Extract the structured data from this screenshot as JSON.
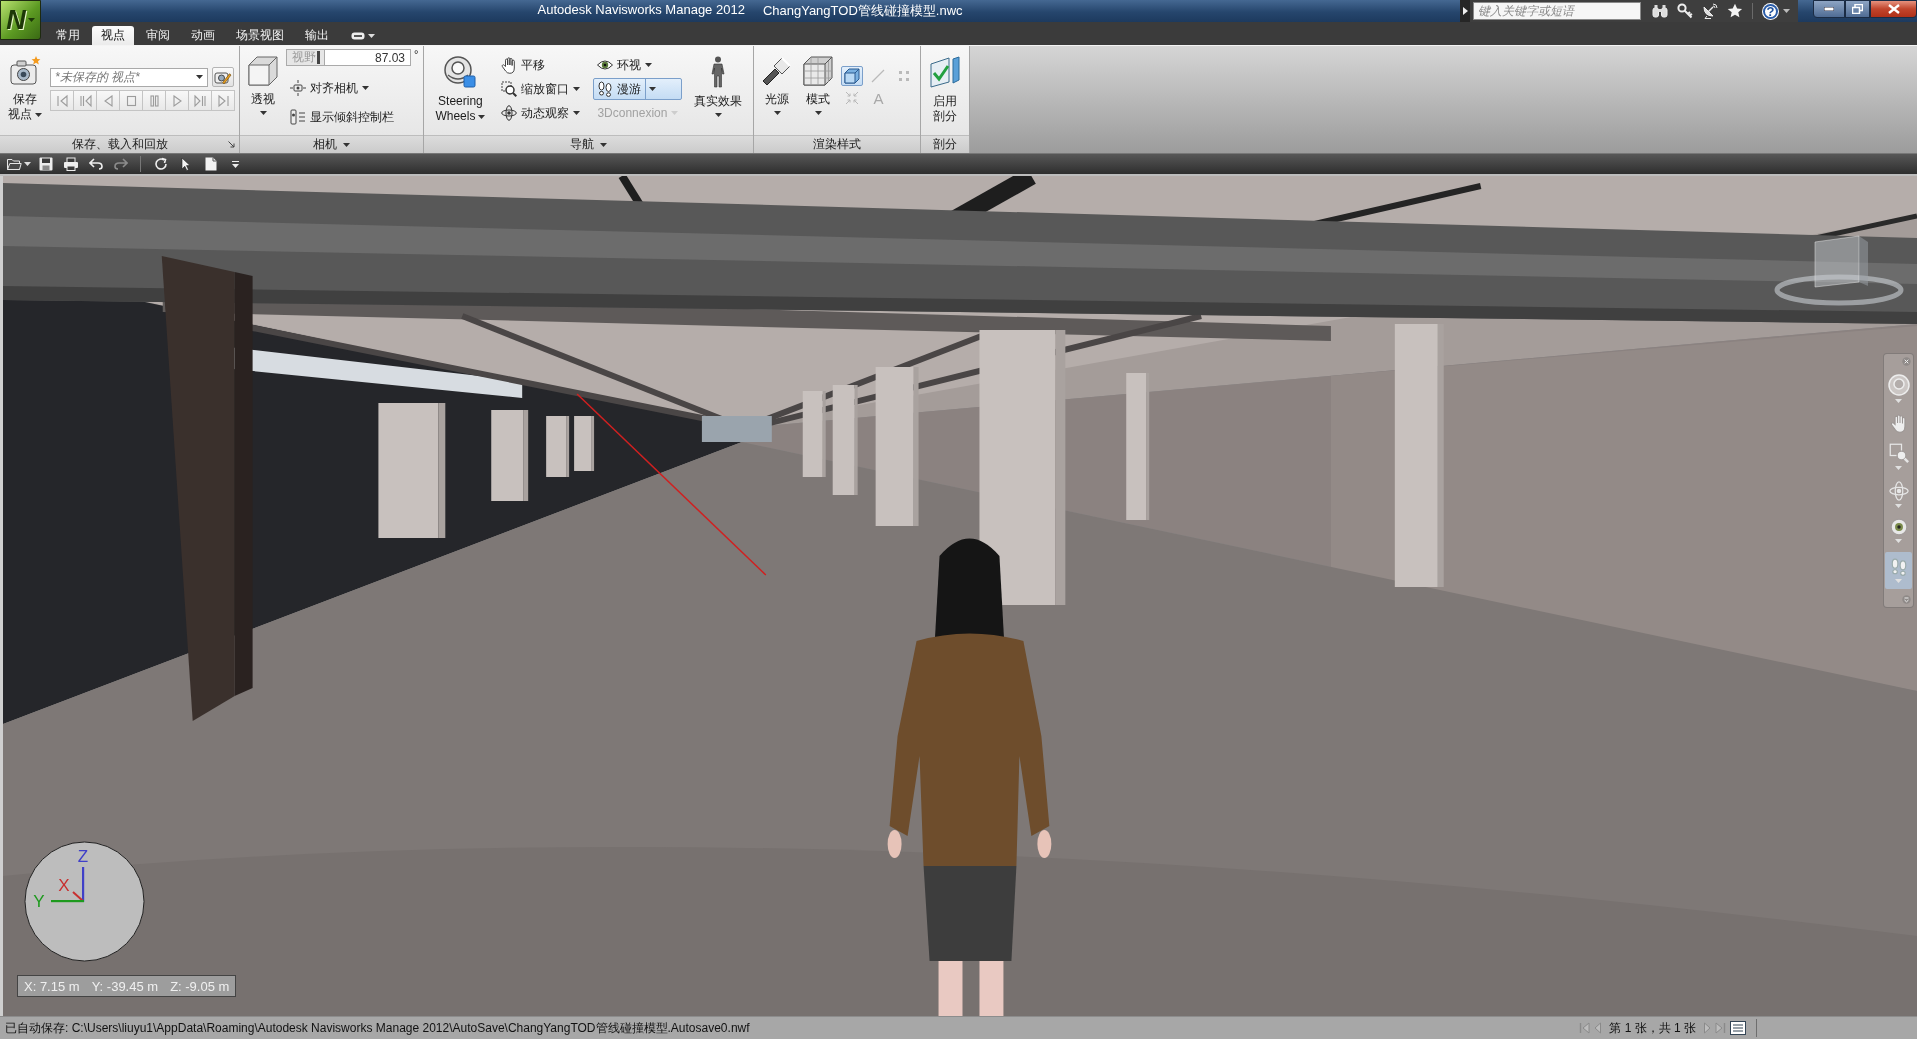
{
  "app_menu": {
    "label": "N"
  },
  "title_bar": {
    "title": "Autodesk Navisworks Manage 2012",
    "document": "ChangYangTOD管线碰撞模型.nwc",
    "search": {
      "placeholder": "键入关键字或短语"
    },
    "help": {
      "label": "?",
      "menu": true
    }
  },
  "ribbon_tabs": [
    {
      "label": "常用",
      "selected": false
    },
    {
      "label": "视点",
      "selected": true
    },
    {
      "label": "审阅",
      "selected": false
    },
    {
      "label": "动画",
      "selected": false
    },
    {
      "label": "场景视图",
      "selected": false
    },
    {
      "label": "输出",
      "selected": false
    }
  ],
  "ribbon_panels": [
    {
      "title": "保存、载入和回放",
      "menu": false,
      "launcher": true,
      "columns": [
        [
          {
            "kind": "large",
            "lines": [
              "保存",
              "视点"
            ],
            "menu": true
          }
        ],
        [
          {
            "kind": "combo",
            "value": "*未保存的 视点*"
          },
          {
            "kind": "playback",
            "disabled": true
          }
        ]
      ]
    },
    {
      "title": "相机",
      "menu": true,
      "launcher": false,
      "columns": [
        [
          {
            "kind": "large",
            "lines": [
              "透视"
            ],
            "menu": true
          }
        ],
        [
          {
            "kind": "spin",
            "label": "视野",
            "level": 0.88,
            "value": "87.03",
            "unit": "°"
          },
          {
            "kind": "small",
            "label": "对齐相机",
            "menu": true,
            "selected": false,
            "disabled": false
          },
          {
            "kind": "small",
            "label": "显示倾斜控制栏",
            "menu": false,
            "selected": false,
            "disabled": false
          }
        ]
      ]
    },
    {
      "title": "导航",
      "menu": true,
      "launcher": false,
      "columns": [
        [
          {
            "kind": "large",
            "lines": [
              "Steering",
              "Wheels"
            ],
            "menu": true
          }
        ],
        [
          {
            "kind": "small",
            "label": "平移",
            "menu": false,
            "selected": false,
            "disabled": false
          },
          {
            "kind": "small",
            "label": "缩放窗口",
            "menu": true,
            "selected": false,
            "disabled": false
          },
          {
            "kind": "small",
            "label": "动态观察",
            "menu": true,
            "selected": false,
            "disabled": false
          }
        ],
        [
          {
            "kind": "small",
            "label": "环视",
            "menu": true,
            "selected": false,
            "disabled": false
          },
          {
            "kind": "small",
            "label": "漫游",
            "menu": true,
            "selected": true,
            "disabled": false
          },
          {
            "kind": "small",
            "label": "3Dconnexion",
            "menu": true,
            "selected": false,
            "disabled": true
          }
        ],
        [
          {
            "kind": "large",
            "lines": [
              "真实效果"
            ],
            "menu": true
          }
        ]
      ]
    },
    {
      "title": "渲染样式",
      "menu": false,
      "launcher": false,
      "columns": [
        [
          {
            "kind": "large",
            "lines": [
              "光源"
            ],
            "menu": true
          }
        ],
        [
          {
            "kind": "large",
            "lines": [
              "模式"
            ],
            "menu": true
          }
        ],
        [
          {
            "kind": "icons",
            "buttons": [
              {
                "selected": true,
                "disabled": false
              },
              {
                "selected": false,
                "disabled": true
              },
              {
                "selected": false,
                "disabled": true
              }
            ]
          },
          {
            "kind": "icons",
            "buttons": [
              {
                "selected": false,
                "disabled": true
              },
              {
                "selected": false,
                "disabled": true,
                "label": "A"
              }
            ]
          }
        ]
      ]
    },
    {
      "title": "剖分",
      "menu": false,
      "launcher": false,
      "columns": [
        [
          {
            "kind": "large",
            "lines": [
              "启用",
              "剖分"
            ],
            "menu": false
          }
        ]
      ]
    }
  ],
  "viewport": {
    "navigation_bar": {
      "tools": [
        {
          "selected": false,
          "menu": true
        },
        {
          "selected": false,
          "menu": false
        },
        {
          "selected": false,
          "menu": true
        },
        {
          "selected": false,
          "menu": true
        },
        {
          "selected": false,
          "menu": true
        },
        {
          "selected": true,
          "menu": true
        }
      ]
    },
    "compass": {
      "axes": [
        {
          "label": "Z",
          "color": "#4040c8"
        },
        {
          "label": "X",
          "color": "#c83030"
        },
        {
          "label": "Y",
          "color": "#1e9a1e"
        }
      ]
    },
    "coordinates": [
      "X: 7.15 m",
      "Y: -39.45 m",
      "Z: -9.05 m"
    ]
  },
  "status_bar": {
    "message": "已自动保存: C:\\Users\\liuyu1\\AppData\\Roaming\\Autodesk Navisworks Manage 2012\\AutoSave\\ChangYangTOD管线碰撞模型.Autosave0.nwf",
    "sheet": "第 1 张，共 1 张"
  }
}
